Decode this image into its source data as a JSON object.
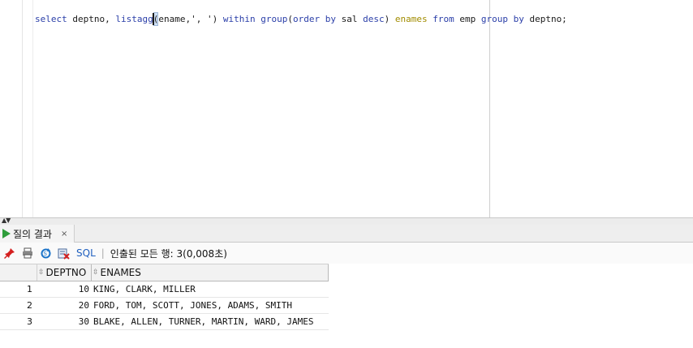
{
  "editor": {
    "tokens": [
      {
        "text": "select",
        "cls": "kw"
      },
      {
        "text": " deptno, ",
        "cls": "plain"
      },
      {
        "text": "listagg",
        "cls": "kw"
      },
      {
        "text": "(",
        "cls": "paren"
      },
      {
        "text": "ename,', ') ",
        "cls": "plain"
      },
      {
        "text": "within",
        "cls": "kw"
      },
      {
        "text": " ",
        "cls": "plain"
      },
      {
        "text": "group",
        "cls": "kw"
      },
      {
        "text": "(",
        "cls": "plain"
      },
      {
        "text": "order",
        "cls": "kw"
      },
      {
        "text": " ",
        "cls": "plain"
      },
      {
        "text": "by",
        "cls": "kw"
      },
      {
        "text": " sal ",
        "cls": "plain"
      },
      {
        "text": "desc",
        "cls": "kw"
      },
      {
        "text": ") ",
        "cls": "plain"
      },
      {
        "text": "enames",
        "cls": "alias"
      },
      {
        "text": " ",
        "cls": "plain"
      },
      {
        "text": "from",
        "cls": "kw"
      },
      {
        "text": " emp ",
        "cls": "plain"
      },
      {
        "text": "group",
        "cls": "kw"
      },
      {
        "text": " ",
        "cls": "plain"
      },
      {
        "text": "by",
        "cls": "kw"
      },
      {
        "text": " deptno;",
        "cls": "plain"
      }
    ]
  },
  "results": {
    "tab_label": "질의 결과",
    "tab_close": "×",
    "toolbar": {
      "sql_label": "SQL",
      "separator": "|",
      "status": "인출된 모든 행: 3(0,008초)"
    },
    "columns": [
      "DEPTNO",
      "ENAMES"
    ],
    "rows": [
      {
        "num": "1",
        "deptno": "10",
        "enames": "KING, CLARK, MILLER"
      },
      {
        "num": "2",
        "deptno": "20",
        "enames": "FORD, TOM, SCOTT, JONES, ADAMS, SMITH"
      },
      {
        "num": "3",
        "deptno": "30",
        "enames": "BLAKE, ALLEN, TURNER, MARTIN, WARD, JAMES"
      }
    ]
  },
  "icons": {
    "pin": "pin-icon",
    "print": "print-icon",
    "refresh": "refresh-icon",
    "export": "export-icon",
    "run": "run-icon"
  }
}
